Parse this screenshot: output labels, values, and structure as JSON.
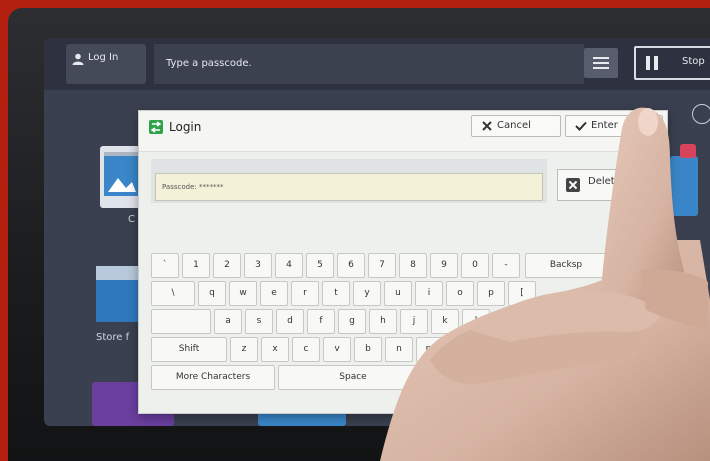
{
  "topbar": {
    "login_label": "Log In",
    "instruction": "Type a passcode.",
    "stop_label": "Stop"
  },
  "background": {
    "copy_partial": "C",
    "store_partial": "Store f"
  },
  "dialog": {
    "title": "Login",
    "cancel_label": "Cancel",
    "enter_label": "Enter",
    "passcode_text": "Passcode: *******",
    "delete_label": "Delete T"
  },
  "keyboard": {
    "row1": [
      "`",
      "1",
      "2",
      "3",
      "4",
      "5",
      "6",
      "7",
      "8",
      "9",
      "0",
      "-"
    ],
    "backspace": "Backsp",
    "row2": [
      "\\",
      "q",
      "w",
      "e",
      "r",
      "t",
      "y",
      "u",
      "i",
      "o",
      "p",
      "["
    ],
    "row3": [
      "a",
      "s",
      "d",
      "f",
      "g",
      "h",
      "j",
      "k",
      "l"
    ],
    "shift": "Shift",
    "row4": [
      "z",
      "x",
      "c",
      "v",
      "b",
      "n",
      "m"
    ],
    "more_characters": "More Characters",
    "space": "Space"
  },
  "colors": {
    "frame": "#b3200f",
    "login_icon": "#2ea34a",
    "tile_blue": "#3a86c8",
    "tile_purple": "#6a3fa0",
    "lock_badge": "#d6435a"
  }
}
